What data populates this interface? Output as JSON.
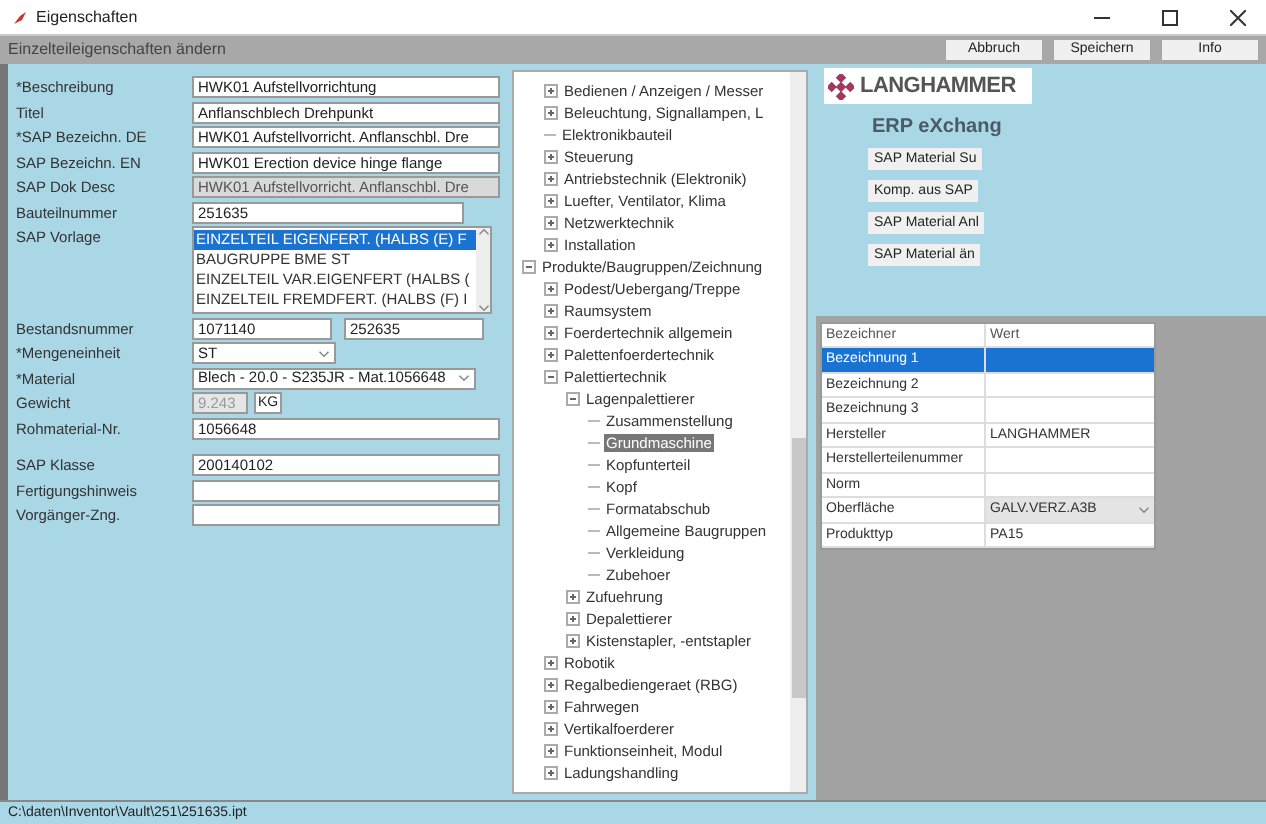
{
  "window": {
    "title": "Eigenschaften"
  },
  "header": {
    "title": "Einzelteileigenschaften ändern",
    "buttons": [
      "Abbruch",
      "Speichern",
      "Info"
    ]
  },
  "form": {
    "fields": [
      {
        "label": "*Beschreibung",
        "kind": "text",
        "value": "HWK01 Aufstellvorrichtung",
        "disabled": false
      },
      {
        "label": "Titel",
        "kind": "text",
        "value": "Anflanschblech Drehpunkt",
        "disabled": false
      },
      {
        "label": "*SAP Bezeichn. DE",
        "kind": "text",
        "value": "HWK01 Aufstellvorricht. Anflanschbl. Dre",
        "disabled": false
      },
      {
        "label": "SAP Bezeichn. EN",
        "kind": "text",
        "value": "HWK01 Erection device hinge flange",
        "disabled": false
      },
      {
        "label": "SAP Dok Desc",
        "kind": "text",
        "value": "HWK01 Aufstellvorricht. Anflanschbl. Dre",
        "disabled": true
      },
      {
        "label": "Bauteilnummer",
        "kind": "text_short",
        "value": "251635",
        "disabled": false
      },
      {
        "label": "SAP Vorlage",
        "kind": "list",
        "options": [
          {
            "label": "EINZELTEIL EIGENFERT. (HALBS (E) F",
            "selected": true
          },
          {
            "label": "BAUGRUPPE BME ST",
            "selected": false
          },
          {
            "label": "EINZELTEIL VAR.EIGENFERT (HALBS (",
            "selected": false
          },
          {
            "label": "EINZELTEIL FREMDFERT. (HALBS (F) I",
            "selected": false
          }
        ]
      },
      {
        "label": "Bestandsnummer",
        "kind": "pair",
        "values": [
          "1071140",
          "252635"
        ]
      },
      {
        "label": "*Mengeneinheit",
        "kind": "dropdown_short",
        "value": "ST"
      },
      {
        "label": "*Material",
        "kind": "dropdown",
        "value": "Blech - 20.0 - S235JR - Mat.1056648"
      },
      {
        "label": "Gewicht",
        "kind": "weight",
        "value": "9.243",
        "unit": "KG",
        "disabled": true
      },
      {
        "label": "Rohmaterial-Nr.",
        "kind": "text",
        "value": "1056648",
        "disabled": false
      },
      {
        "label": "SAP Klasse",
        "kind": "text",
        "value": "200140102",
        "disabled": false
      },
      {
        "label": "Fertigungshinweis",
        "kind": "text",
        "disabled": false
      },
      {
        "label": "Vorgänger-Zng.",
        "kind": "text",
        "disabled": false
      }
    ]
  },
  "tree": {
    "items": [
      {
        "children": [
          {
            "label": "Bedienen / Anzeigen / Messer",
            "expanded": false,
            "selected": false
          },
          {
            "label": "Beleuchtung, Signallampen, L",
            "expanded": false,
            "selected": false
          },
          {
            "label": "Elektronikbauteil",
            "selected": false
          },
          {
            "label": "Steuerung",
            "expanded": false,
            "selected": false
          },
          {
            "label": "Antriebstechnik (Elektronik)",
            "expanded": false,
            "selected": false
          },
          {
            "label": "Luefter, Ventilator, Klima",
            "expanded": false,
            "selected": false
          },
          {
            "label": "Netzwerktechnik",
            "expanded": false,
            "selected": false
          },
          {
            "label": "Installation",
            "expanded": false,
            "selected": false
          }
        ]
      },
      {
        "label": "Produkte/Baugruppen/Zeichnung",
        "expanded": true,
        "selected": false,
        "children": [
          {
            "label": "Podest/Uebergang/Treppe",
            "expanded": false,
            "selected": false
          },
          {
            "label": "Raumsystem",
            "expanded": false,
            "selected": false
          },
          {
            "label": "Foerdertechnik allgemein",
            "expanded": false,
            "selected": false
          },
          {
            "label": "Palettenfoerdertechnik",
            "expanded": false,
            "selected": false
          },
          {
            "label": "Palettiertechnik",
            "expanded": true,
            "selected": false,
            "children": [
              {
                "label": "Lagenpalettierer",
                "expanded": true,
                "selected": false,
                "children": [
                  {
                    "label": "Zusammenstellung",
                    "selected": false
                  },
                  {
                    "label": "Grundmaschine",
                    "selected": true
                  },
                  {
                    "label": "Kopfunterteil",
                    "selected": false
                  },
                  {
                    "label": "Kopf",
                    "selected": false
                  },
                  {
                    "label": "Formatabschub",
                    "selected": false
                  },
                  {
                    "label": "Allgemeine Baugruppen",
                    "selected": false
                  },
                  {
                    "label": "Verkleidung",
                    "selected": false
                  },
                  {
                    "label": "Zubehoer",
                    "selected": false
                  }
                ]
              },
              {
                "label": "Zufuehrung",
                "expanded": false,
                "selected": false
              },
              {
                "label": "Depalettierer",
                "expanded": false,
                "selected": false
              },
              {
                "label": "Kistenstapler, -entstapler",
                "expanded": false,
                "selected": false
              }
            ]
          },
          {
            "label": "Robotik",
            "expanded": false,
            "selected": false
          },
          {
            "label": "Regalbediengeraet (RBG)",
            "expanded": false,
            "selected": false
          },
          {
            "label": "Fahrwegen",
            "expanded": false,
            "selected": false
          },
          {
            "label": "Vertikalfoerderer",
            "expanded": false,
            "selected": false
          },
          {
            "label": "Funktionseinheit, Modul",
            "expanded": false,
            "selected": false
          },
          {
            "label": "Ladungshandling",
            "expanded": false,
            "selected": false
          }
        ]
      }
    ]
  },
  "erp": {
    "logo": "LANGHAMMER",
    "heading": "ERP eXchang",
    "buttons": [
      "SAP Material Su",
      "Komp. aus SAP",
      "SAP Material Anl",
      "SAP Material än"
    ]
  },
  "grid": {
    "columns": [
      "Bezeichner",
      "Wert"
    ],
    "rows": [
      {
        "name": "Bezeichnung 1",
        "kind": "text",
        "selected": true
      },
      {
        "name": "Bezeichnung 2",
        "kind": "text",
        "selected": false
      },
      {
        "name": "Bezeichnung 3",
        "kind": "text",
        "selected": false
      },
      {
        "name": "Hersteller",
        "kind": "text",
        "value": "LANGHAMMER",
        "selected": false
      },
      {
        "name": "Herstellerteilenummer",
        "kind": "text",
        "selected": false
      },
      {
        "name": "Norm",
        "kind": "text",
        "selected": false
      },
      {
        "name": "Oberfläche",
        "kind": "dropdown",
        "value": "GALV.VERZ.A3B",
        "selected": false
      },
      {
        "name": "Produkttyp",
        "kind": "text",
        "value": "PA15",
        "selected": false
      }
    ]
  },
  "status_bar": "C:\\daten\\Inventor\\Vault\\251\\251635.ipt"
}
